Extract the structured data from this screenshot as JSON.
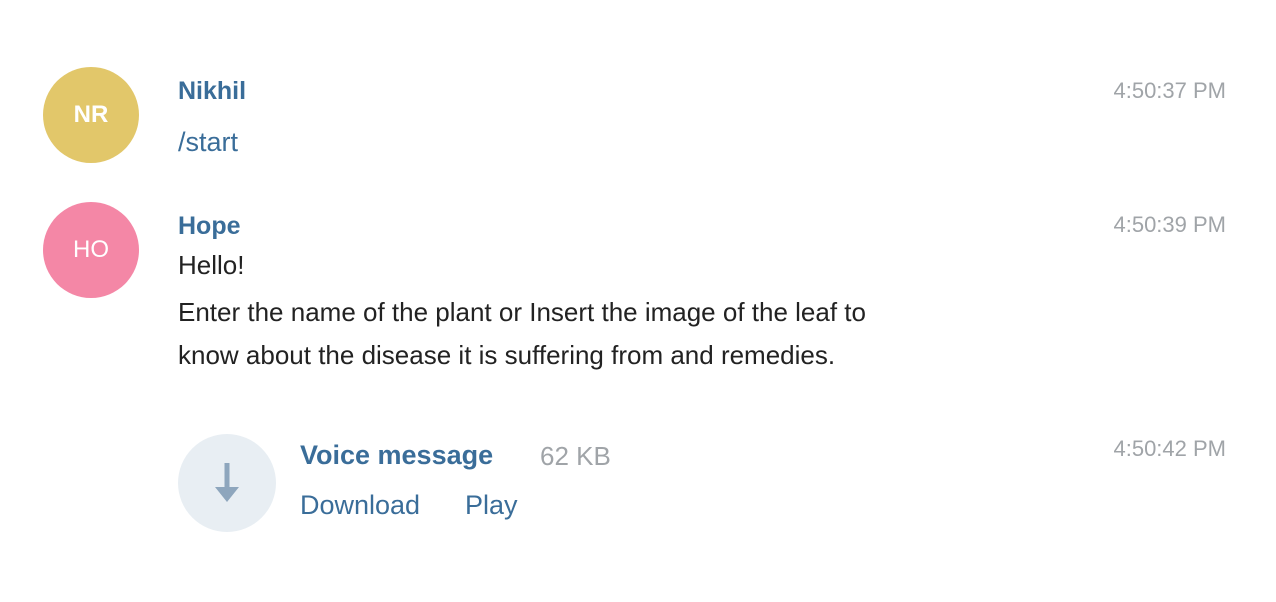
{
  "messages": [
    {
      "avatar_initials": "NR",
      "avatar_color": "#e2c76a",
      "sender": "Nikhil",
      "time": "4:50:37 PM",
      "text": "/start"
    },
    {
      "avatar_initials": "HO",
      "avatar_color": "#f487a6",
      "sender": "Hope",
      "time": "4:50:39 PM",
      "lines": [
        "Hello!",
        "Enter the name of the plant or Insert the image of the leaf to",
        "know about the disease it is suffering from and remedies."
      ]
    }
  ],
  "voice_message": {
    "icon": "download-arrow-icon",
    "title": "Voice message",
    "size": "62 KB",
    "download_label": "Download",
    "play_label": "Play",
    "time": "4:50:42 PM"
  }
}
